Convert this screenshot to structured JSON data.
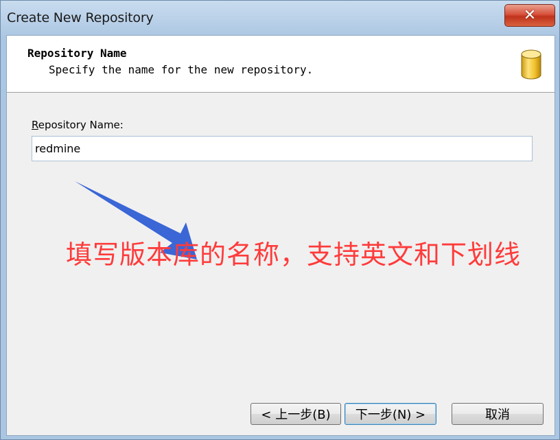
{
  "window": {
    "title": "Create New Repository",
    "close_icon": "close-icon"
  },
  "header": {
    "title": "Repository Name",
    "subtitle": "Specify the name for the new repository.",
    "icon": "database-icon"
  },
  "form": {
    "label_underlined": "R",
    "label_rest": "epository Name:",
    "value": "redmine"
  },
  "annotation": {
    "text": "填写版本库的名称，支持英文和下划线",
    "color": "#ff3b3b",
    "arrow_color": "#3a66d6"
  },
  "buttons": {
    "back": "< 上一步(B)",
    "next": "下一步(N) >",
    "cancel": "取消"
  }
}
